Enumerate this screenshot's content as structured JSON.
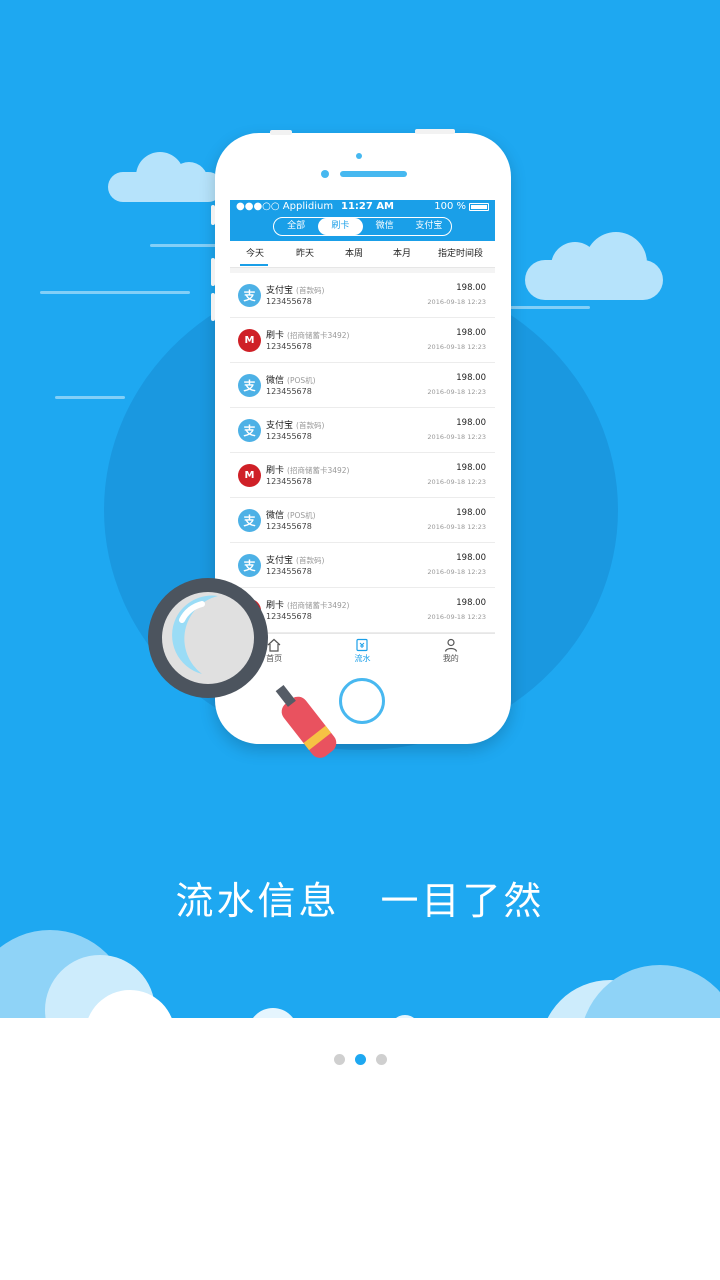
{
  "headline": "流水信息　一目了然",
  "pager": {
    "count": 3,
    "active_index": 1
  },
  "phone": {
    "status_bar": {
      "carrier": "●●●○○ Applidium",
      "time": "11:27 AM",
      "battery": "100 %"
    },
    "segments": [
      {
        "label": "全部",
        "active": false
      },
      {
        "label": "刷卡",
        "active": true
      },
      {
        "label": "微信",
        "active": false
      },
      {
        "label": "支付宝",
        "active": false
      }
    ],
    "date_tabs": [
      {
        "label": "今天",
        "active": true
      },
      {
        "label": "昨天",
        "active": false
      },
      {
        "label": "本周",
        "active": false
      },
      {
        "label": "本月",
        "active": false
      },
      {
        "label": "指定时间段",
        "active": false
      }
    ],
    "transactions": [
      {
        "icon": "alipay-icon",
        "name": "支付宝",
        "detail": "(首款码)",
        "number": "123455678",
        "amount": "198.00",
        "date": "2016-09-18 12:23"
      },
      {
        "icon": "bank-card-icon",
        "name": "刷卡",
        "detail": "(招商储蓄卡3492)",
        "number": "123455678",
        "amount": "198.00",
        "date": "2016-09-18 12:23"
      },
      {
        "icon": "wechat-icon",
        "name": "微信",
        "detail": "(POS机)",
        "number": "123455678",
        "amount": "198.00",
        "date": "2016-09-18 12:23"
      },
      {
        "icon": "alipay-icon",
        "name": "支付宝",
        "detail": "(首款码)",
        "number": "123455678",
        "amount": "198.00",
        "date": "2016-09-18 12:23"
      },
      {
        "icon": "bank-card-icon",
        "name": "刷卡",
        "detail": "(招商储蓄卡3492)",
        "number": "123455678",
        "amount": "198.00",
        "date": "2016-09-18 12:23"
      },
      {
        "icon": "wechat-icon",
        "name": "微信",
        "detail": "(POS机)",
        "number": "123455678",
        "amount": "198.00",
        "date": "2016-09-18 12:23"
      },
      {
        "icon": "alipay-icon",
        "name": "支付宝",
        "detail": "(首款码)",
        "number": "123455678",
        "amount": "198.00",
        "date": "2016-09-18 12:23"
      },
      {
        "icon": "bank-card-icon",
        "name": "刷卡",
        "detail": "(招商储蓄卡3492)",
        "number": "123455678",
        "amount": "198.00",
        "date": "2016-09-18 12:23"
      }
    ],
    "tab_bar": [
      {
        "label": "首页",
        "icon": "home-icon",
        "active": false
      },
      {
        "label": "流水",
        "icon": "ledger-icon",
        "active": true
      },
      {
        "label": "我的",
        "icon": "user-icon",
        "active": false
      }
    ]
  },
  "colors": {
    "primary": "#1ea8f1",
    "card_red": "#cf2027",
    "cloud": "#b6e3fb"
  }
}
